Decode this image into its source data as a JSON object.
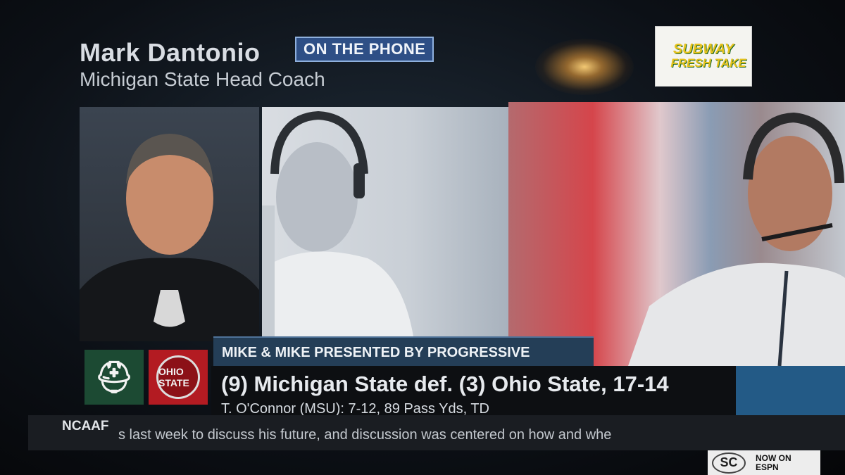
{
  "header": {
    "name": "Mark Dantonio",
    "title": "Michigan State Head Coach",
    "badge": "ON THE PHONE"
  },
  "sponsor": {
    "line1": "SUBWAY",
    "line2": "FRESH TAKE"
  },
  "photos": {
    "left": "person-icon",
    "middle": "person-icon",
    "right": "person-icon"
  },
  "lower_third": {
    "show_title": "MIKE & MIKE PRESENTED BY PROGRESSIVE",
    "headline": "(9) Michigan State def. (3) Ohio State, 17-14",
    "stat": "T. O'Connor (MSU): 7-12, 89 Pass Yds, TD",
    "team_logos": {
      "left": "spartan-helmet",
      "right": "OHIO STATE"
    }
  },
  "ticker": {
    "label": "NCAAF",
    "text": "s last week to discuss his future, and discussion was centered on how and whe"
  },
  "network_bug": {
    "logo": "SC",
    "line1": "NOW ON",
    "line2": "ESPN"
  },
  "colors": {
    "badge_bg": "#2e4f86",
    "msu_green": "#1c4a33",
    "osu_red": "#b31b22",
    "band_blue": "#235a86"
  }
}
